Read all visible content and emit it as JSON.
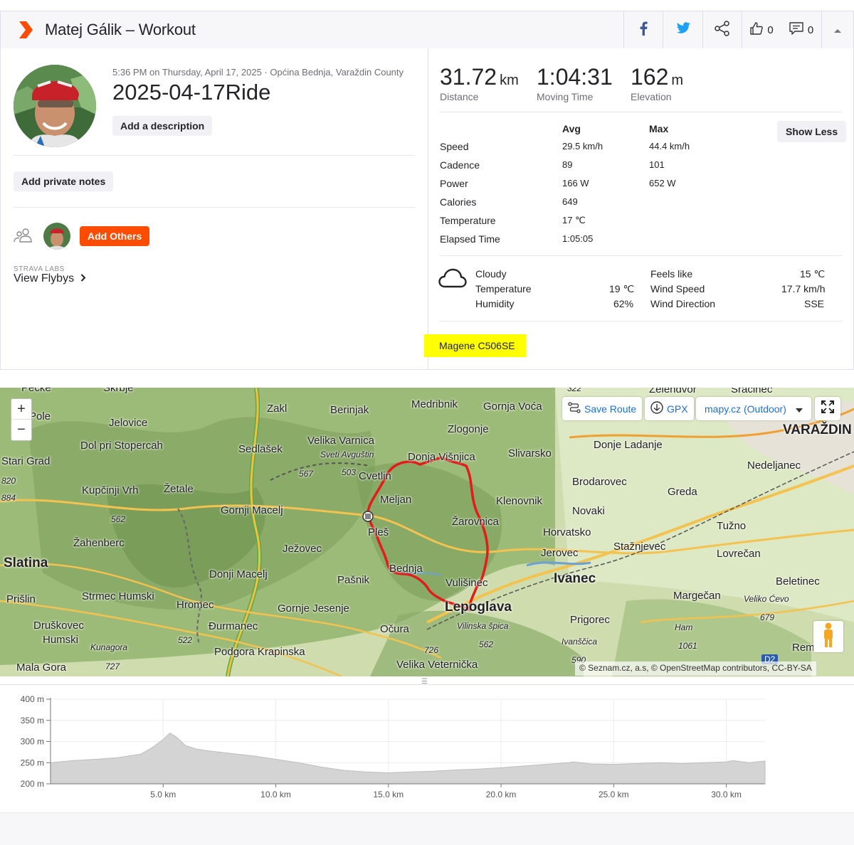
{
  "header": {
    "title": "Matej Gálik – Workout",
    "kudos_count": "0",
    "comments_count": "0"
  },
  "athlete": {
    "meta_line": "5:36 PM on Thursday, April 17, 2025 · Općina Bednja, Varaždin County",
    "activity_name": "2025-04-17Ride",
    "add_description_label": "Add a description",
    "add_private_notes_label": "Add private notes",
    "add_others_label": "Add Others",
    "strava_labs_label": "STRAVA LABS",
    "view_flybys_label": "View Flybys"
  },
  "stats": {
    "distance": {
      "value": "31.72",
      "unit": "km",
      "label": "Distance"
    },
    "moving_time": {
      "value": "1:04:31",
      "label": "Moving Time"
    },
    "elevation": {
      "value": "162",
      "unit": "m",
      "label": "Elevation"
    }
  },
  "details": {
    "avg_header": "Avg",
    "max_header": "Max",
    "show_less_label": "Show Less",
    "rows": [
      {
        "label": "Speed",
        "avg": "29.5 km/h",
        "max": "44.4 km/h"
      },
      {
        "label": "Cadence",
        "avg": "89",
        "max": "101"
      },
      {
        "label": "Power",
        "avg": "166 W",
        "max": "652 W"
      },
      {
        "label": "Calories",
        "avg": "649",
        "max": ""
      },
      {
        "label": "Temperature",
        "avg": "17 ℃",
        "max": ""
      },
      {
        "label": "Elapsed Time",
        "avg": "1:05:05",
        "max": ""
      }
    ]
  },
  "weather": {
    "condition": "Cloudy",
    "temperature_label": "Temperature",
    "temperature_value": "19 ℃",
    "humidity_label": "Humidity",
    "humidity_value": "62%",
    "feels_like_label": "Feels like",
    "feels_like_value": "15 ℃",
    "wind_speed_label": "Wind Speed",
    "wind_speed_value": "17.7 km/h",
    "wind_direction_label": "Wind Direction",
    "wind_direction_value": "SSE"
  },
  "device": "Magene C506SE",
  "map": {
    "zoom_in": "+",
    "zoom_out": "−",
    "save_route_label": "Save Route",
    "gpx_label": "GPX",
    "layer_label": "mapy.cz (Outdoor)",
    "attribution": "© Seznam.cz, a.s, © OpenStreetMap contributors, CC-BY-SA",
    "places": [
      {
        "name": "Pecke",
        "cls": ""
      },
      {
        "name": "Skrbje",
        "cls": ""
      },
      {
        "name": "Zelendvor",
        "cls": ""
      },
      {
        "name": "Sracinec",
        "cls": ""
      },
      {
        "name": "Zakl",
        "cls": ""
      },
      {
        "name": "Berinjak",
        "cls": ""
      },
      {
        "name": "Medribnik",
        "cls": ""
      },
      {
        "name": "Gornja Voća",
        "cls": ""
      },
      {
        "name": "Zlogonje",
        "cls": ""
      },
      {
        "name": "Jelovice",
        "cls": ""
      },
      {
        "name": "Pole",
        "cls": ""
      },
      {
        "name": "Dol pri Stopercah",
        "cls": ""
      },
      {
        "name": "Sedlašek",
        "cls": ""
      },
      {
        "name": "Velika Varnica",
        "cls": ""
      },
      {
        "name": "Sveti Avguštin",
        "cls": "sm"
      },
      {
        "name": "Donja Višnjica",
        "cls": ""
      },
      {
        "name": "Slivarsko",
        "cls": ""
      },
      {
        "name": "Donje Ladanje",
        "cls": ""
      },
      {
        "name": "VARAŽDIN",
        "cls": "big"
      },
      {
        "name": "Stari Grad",
        "cls": ""
      },
      {
        "name": "Cvetlin",
        "cls": ""
      },
      {
        "name": "Nedeljanec",
        "cls": ""
      },
      {
        "name": "Kupčinji Vrh",
        "cls": ""
      },
      {
        "name": "Žetale",
        "cls": ""
      },
      {
        "name": "Meljan",
        "cls": ""
      },
      {
        "name": "Brodarovec",
        "cls": ""
      },
      {
        "name": "Klenovnik",
        "cls": ""
      },
      {
        "name": "Greda",
        "cls": ""
      },
      {
        "name": "Gornji Macelj",
        "cls": ""
      },
      {
        "name": "Novaki",
        "cls": ""
      },
      {
        "name": "Žarovnica",
        "cls": ""
      },
      {
        "name": "Tužno",
        "cls": ""
      },
      {
        "name": "Pleš",
        "cls": ""
      },
      {
        "name": "Horvatsko",
        "cls": ""
      },
      {
        "name": "Žahenberc",
        "cls": ""
      },
      {
        "name": "Ježovec",
        "cls": ""
      },
      {
        "name": "Jerovec",
        "cls": ""
      },
      {
        "name": "Stažnjevec",
        "cls": ""
      },
      {
        "name": "Lovrečan",
        "cls": ""
      },
      {
        "name": "Slatina",
        "cls": "big"
      },
      {
        "name": "Bednja",
        "cls": ""
      },
      {
        "name": "Donji Macelj",
        "cls": ""
      },
      {
        "name": "Pašnik",
        "cls": ""
      },
      {
        "name": "Ivanec",
        "cls": "big"
      },
      {
        "name": "Vulišinec",
        "cls": ""
      },
      {
        "name": "Beletinec",
        "cls": ""
      },
      {
        "name": "Prišlin",
        "cls": ""
      },
      {
        "name": "Strmec Humski",
        "cls": ""
      },
      {
        "name": "Margečan",
        "cls": ""
      },
      {
        "name": "Hromec",
        "cls": ""
      },
      {
        "name": "Gornje Jesenje",
        "cls": ""
      },
      {
        "name": "Lepoglava",
        "cls": "big"
      },
      {
        "name": "Veliko Ćevo",
        "cls": "sm"
      },
      {
        "name": "Druškovec",
        "cls": ""
      },
      {
        "name": "Đurmanec",
        "cls": ""
      },
      {
        "name": "Prigorec",
        "cls": ""
      },
      {
        "name": "Humski",
        "cls": ""
      },
      {
        "name": "Očura",
        "cls": ""
      },
      {
        "name": "Vilinska špica",
        "cls": "sm"
      },
      {
        "name": "Ham",
        "cls": "sm"
      },
      {
        "name": "Kunagora",
        "cls": "sm"
      },
      {
        "name": "Podgora Krapinska",
        "cls": ""
      },
      {
        "name": "Ivanščica",
        "cls": "sm"
      },
      {
        "name": "Remetinec",
        "cls": ""
      },
      {
        "name": "Mala Gora",
        "cls": ""
      },
      {
        "name": "Velika Veternička",
        "cls": ""
      }
    ],
    "road_numbers": [
      "322",
      "567",
      "503",
      "820",
      "884",
      "562",
      "522",
      "727",
      "726",
      "562",
      "679",
      "1061",
      "590",
      "D2"
    ]
  },
  "chart_data": {
    "type": "area",
    "ylabel": "",
    "xlabel": "",
    "y_ticks": [
      "200 m",
      "250 m",
      "300 m",
      "350 m",
      "400 m"
    ],
    "x_ticks": [
      "5.0 km",
      "10.0 km",
      "15.0 km",
      "20.0 km",
      "25.0 km",
      "30.0 km"
    ],
    "ylim": [
      200,
      400
    ],
    "xlim": [
      0,
      31.72
    ],
    "x": [
      0,
      1,
      2,
      3,
      4,
      4.5,
      5,
      5.3,
      5.6,
      6,
      6.5,
      7,
      8,
      9,
      10,
      11,
      12,
      13,
      14,
      15,
      16,
      17,
      18,
      19,
      20,
      21,
      22,
      23,
      23.2,
      24,
      25,
      26,
      27,
      28,
      29,
      30,
      30.3,
      31,
      31.72
    ],
    "y": [
      250,
      255,
      258,
      262,
      270,
      285,
      305,
      320,
      310,
      290,
      282,
      278,
      272,
      266,
      258,
      250,
      240,
      232,
      228,
      226,
      228,
      230,
      233,
      235,
      238,
      242,
      246,
      250,
      252,
      247,
      246,
      248,
      250,
      248,
      250,
      252,
      255,
      250,
      254
    ]
  }
}
